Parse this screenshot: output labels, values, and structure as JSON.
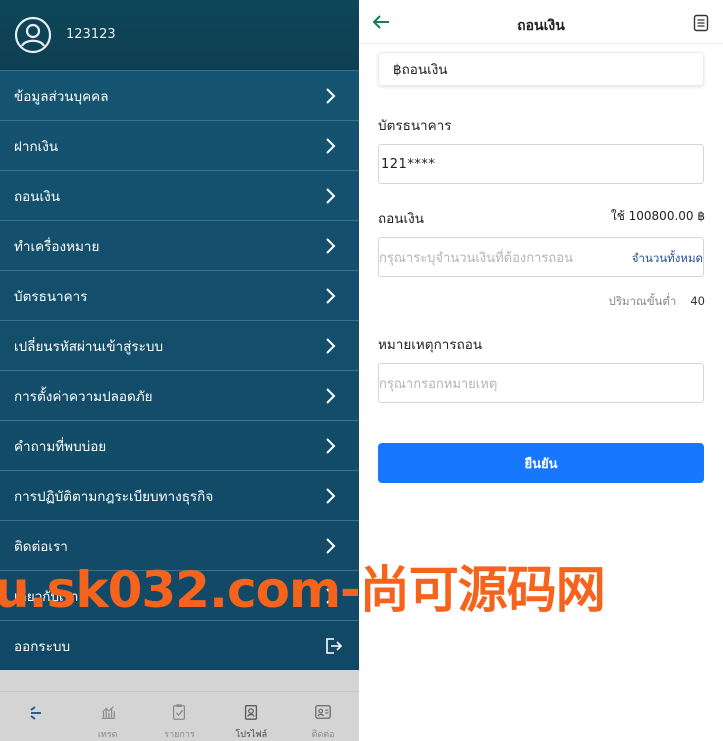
{
  "user": {
    "name": "123123"
  },
  "menu": {
    "items": [
      {
        "label": "ข้อมูลส่วนบุคคล"
      },
      {
        "label": "ฝากเงิน"
      },
      {
        "label": "ถอนเงิน"
      },
      {
        "label": "ทำเครื่องหมาย"
      },
      {
        "label": "บัตรธนาคาร"
      },
      {
        "label": "เปลี่ยนรหัสผ่านเข้าสู่ระบบ"
      },
      {
        "label": "การตั้งค่าความปลอดภัย"
      },
      {
        "label": "คำถามที่พบบ่อย"
      },
      {
        "label": "การปฏิบัติตามกฎระเบียบทางธุรกิจ"
      },
      {
        "label": "ติดต่อเรา"
      },
      {
        "label": "เกี่ยวกับเรา"
      }
    ],
    "logout": "ออกระบบ"
  },
  "bottom_nav": [
    {
      "label": "",
      "icon": "home-icon"
    },
    {
      "label": "เทรด",
      "icon": "chart-icon"
    },
    {
      "label": "รายการ",
      "icon": "clipboard-check-icon"
    },
    {
      "label": "โปรไฟล์",
      "icon": "badge-icon"
    },
    {
      "label": "ติดต่อ",
      "icon": "contact-card-icon"
    }
  ],
  "withdraw": {
    "title": "ถอนเงิน",
    "method": "฿ถอนเงิน",
    "bank_card_label": "บัตรธนาคาร",
    "bank_card_value": "121****",
    "amount_label": "ถอนเงิน",
    "available": "ใช้ 100800.00 ฿",
    "amount_placeholder": "กรุณาระบุจำนวนเงินที่ต้องการถอน",
    "all_amount": "จำนวนทั้งหมด",
    "min_label": "ปริมาณขั้นต่ำ",
    "min_value": "40",
    "remark_label": "หมายเหตุการถอน",
    "remark_placeholder": "กรุณากรอกหมายเหตุ",
    "confirm": "ยืนยัน"
  },
  "watermark": "u.sk032.com-尚可源码网",
  "colors": {
    "sidebar": "#0f4659",
    "primary_button": "#1777ff",
    "watermark": "#f5631d",
    "link": "#1f4f9c"
  }
}
